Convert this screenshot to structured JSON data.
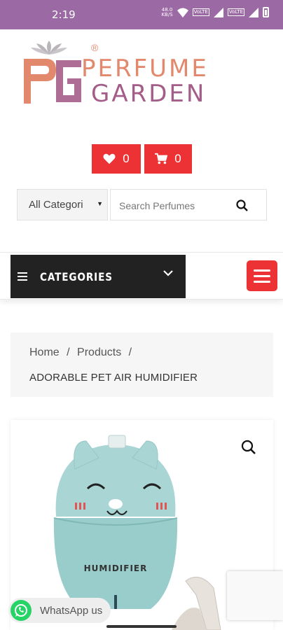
{
  "status_bar": {
    "time": "2:19",
    "net_speed_value": "48.0",
    "net_speed_unit": "KB/S",
    "volte1": "VoLTE",
    "volte2": "VoLTE"
  },
  "logo": {
    "word1": "PERFUME",
    "word2": "GARDEN",
    "reg": "®",
    "icon": "pg-lotus-logo-icon"
  },
  "wishlist": {
    "count": "0",
    "icon": "heart-icon"
  },
  "cart": {
    "count": "0",
    "icon": "cart-icon"
  },
  "search": {
    "category_selected": "All Categori",
    "placeholder": "Search Perfumes",
    "icon": "search-icon"
  },
  "nav": {
    "categories_label": "CATEGORIES",
    "menu_icon": "hamburger-icon"
  },
  "breadcrumb": {
    "home": "Home",
    "sep": "/",
    "products": "Products",
    "current": "ADORABLE PET AIR HUMIDIFIER"
  },
  "product": {
    "image_text": "HUMIDIFIER",
    "zoom_icon": "zoom-icon"
  },
  "whatsapp": {
    "label": "WhatsApp us",
    "icon": "whatsapp-icon"
  },
  "colors": {
    "status_bar": "#9b69a3",
    "accent_red": "#ec3234",
    "logo_orange": "#e2886c",
    "logo_purple": "#a45d88",
    "category_bar": "#222222",
    "product_body": "#a9d6d4"
  }
}
